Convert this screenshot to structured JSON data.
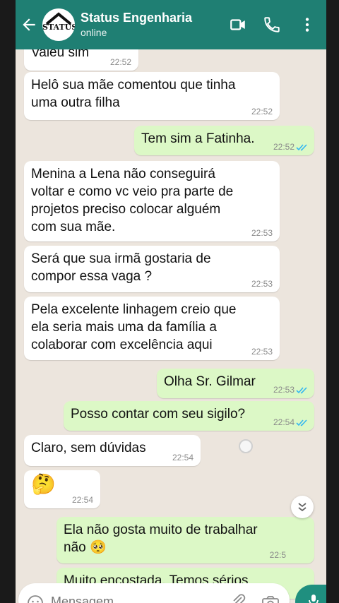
{
  "header": {
    "contact_name": "Status Engenharia",
    "status": "online",
    "avatar_text": "STATUS"
  },
  "messages": [
    {
      "dir": "in",
      "text": "Valeu sim",
      "time": "22:52"
    },
    {
      "dir": "in",
      "text": "Helô sua mãe comentou que tinha\numa outra filha",
      "time": "22:52"
    },
    {
      "dir": "out",
      "text": "Tem sim a Fatinha.",
      "time": "22:52",
      "read": true
    },
    {
      "dir": "in",
      "text": "Menina a Lena não conseguirá\nvoltar e como vc veio pra parte de\nprojetos preciso colocar alguém\ncom sua mãe.",
      "time": "22:53"
    },
    {
      "dir": "in",
      "text": "Será que sua irmã gostaria de\ncompor essa vaga ?",
      "time": "22:53"
    },
    {
      "dir": "in",
      "text": "Pela excelente linhagem creio que\nela seria mais uma da família a\ncolaborar com excelência aqui",
      "time": "22:53"
    },
    {
      "dir": "out",
      "text": "Olha Sr. Gilmar",
      "time": "22:53",
      "read": true
    },
    {
      "dir": "out",
      "text": "Posso contar com seu sigilo?",
      "time": "22:54",
      "read": true
    },
    {
      "dir": "in",
      "text": "Claro, sem dúvidas",
      "time": "22:54"
    },
    {
      "dir": "in",
      "text": "🤔",
      "time": "22:54"
    },
    {
      "dir": "out",
      "text": "Ela não gosta muito de trabalhar\nnão 🥺",
      "time": "22:5"
    },
    {
      "dir": "out",
      "text": "Muito encostada. Temos sérios",
      "time": ""
    }
  ],
  "composer": {
    "placeholder": "Mensagem"
  },
  "colors": {
    "header": "#1f7f73",
    "incoming": "#ffffff",
    "outgoing": "#dcf8c6",
    "chat_bg": "#ece5dd",
    "read_ticks": "#34b7f1"
  },
  "icons": [
    "back-arrow-icon",
    "video-call-icon",
    "phone-icon",
    "more-options-icon",
    "read-ticks-icon",
    "scroll-down-icon",
    "emoji-icon",
    "attach-clip-icon",
    "camera-icon",
    "mic-icon"
  ]
}
